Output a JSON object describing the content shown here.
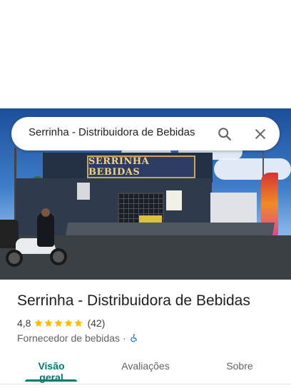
{
  "search": {
    "query": "Serrinha - Distribuidora de Bebidas",
    "search_icon": "search-icon",
    "close_icon": "close-icon"
  },
  "photo": {
    "sign_text": "SERRINHA BEBIDAS"
  },
  "place": {
    "name": "Serrinha - Distribuidora de Bebidas",
    "rating": "4,8",
    "stars": 5,
    "review_count": "(42)",
    "category": "Fornecedor de bebidas",
    "separator": "·",
    "accessibility_icon": "wheelchair-icon"
  },
  "tabs": [
    {
      "label": "Visão geral",
      "active": true
    },
    {
      "label": "Avaliações",
      "active": false
    },
    {
      "label": "Sobre",
      "active": false
    }
  ],
  "colors": {
    "accent": "#01796f",
    "star": "#fbbc04",
    "accessibility": "#1a73e8"
  }
}
